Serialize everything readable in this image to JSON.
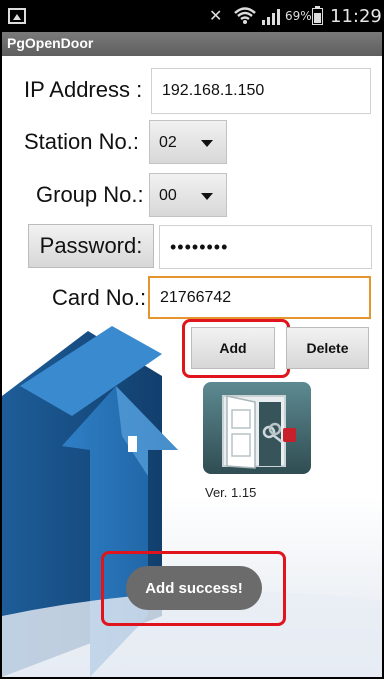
{
  "status_bar": {
    "battery_percent": "69%",
    "time": "11:29"
  },
  "app": {
    "title": "PgOpenDoor",
    "version": "Ver. 1.15"
  },
  "form": {
    "ip_label": "IP Address :",
    "ip_value": "192.168.1.150",
    "station_label": "Station No.:",
    "station_value": "02",
    "group_label": "Group No.:",
    "group_value": "00",
    "password_button": "Password:",
    "password_value": "••••••••",
    "card_label": "Card No.:",
    "card_value": "21766742"
  },
  "buttons": {
    "add": "Add",
    "delete": "Delete"
  },
  "toast": {
    "message": "Add success!"
  },
  "colors": {
    "highlight": "#e0141d",
    "focus": "#e5952e",
    "arrow": "#1f78c1"
  }
}
